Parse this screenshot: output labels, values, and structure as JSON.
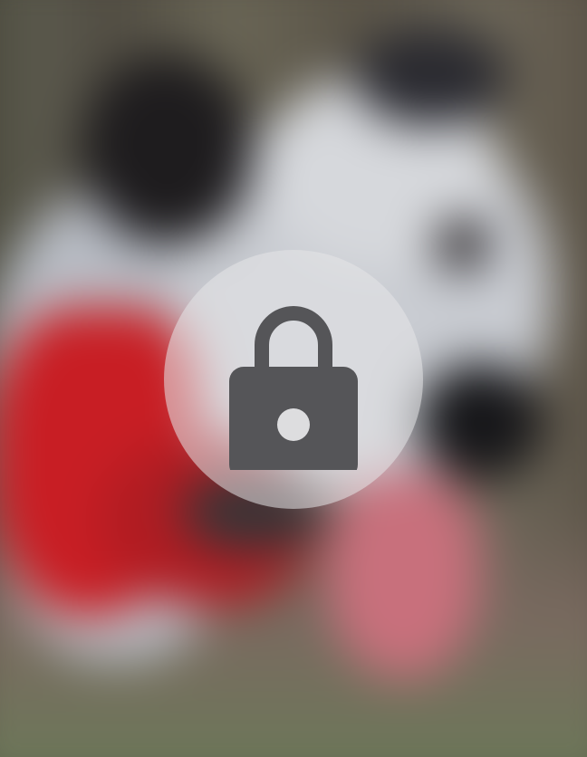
{
  "screen": {
    "state": "locked",
    "background_description_hidden": true
  },
  "lock_badge": {
    "icon": "lock-icon"
  },
  "colors": {
    "badge_fill": "#e6e6e8",
    "lock_fill": "#555558",
    "keyhole": "#dddddf"
  }
}
